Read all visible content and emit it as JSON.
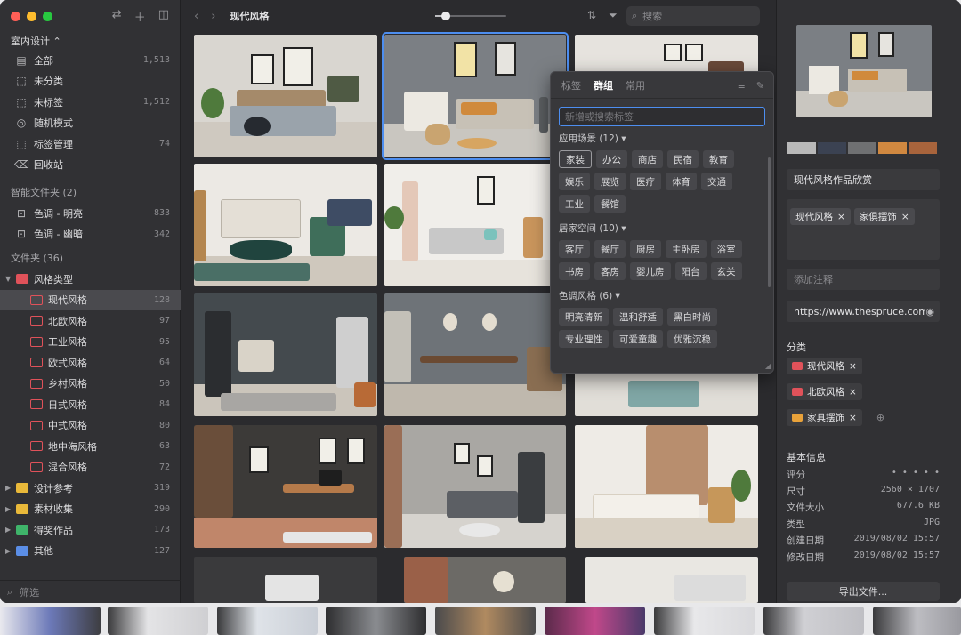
{
  "sidebar": {
    "library": "室内设计 ⌃",
    "items": [
      {
        "icon": "▤",
        "label": "全部",
        "count": "1,513"
      },
      {
        "icon": "⬚",
        "label": "未分类",
        "count": ""
      },
      {
        "icon": "⬚",
        "label": "未标签",
        "count": "1,512"
      },
      {
        "icon": "◎",
        "label": "随机模式",
        "count": ""
      },
      {
        "icon": "⬚",
        "label": "标签管理",
        "count": "74"
      },
      {
        "icon": "⌫",
        "label": "回收站",
        "count": ""
      }
    ],
    "smart_title": "智能文件夹 (2)",
    "smart": [
      {
        "label": "色调 - 明亮",
        "count": "833"
      },
      {
        "label": "色调 - 幽暗",
        "count": "342"
      }
    ],
    "folders_title": "文件夹 (36)",
    "style_root": {
      "label": "风格类型",
      "count": ""
    },
    "style_children": [
      {
        "label": "现代风格",
        "count": "128"
      },
      {
        "label": "北欧风格",
        "count": "97"
      },
      {
        "label": "工业风格",
        "count": "95"
      },
      {
        "label": "欧式风格",
        "count": "64"
      },
      {
        "label": "乡村风格",
        "count": "50"
      },
      {
        "label": "日式风格",
        "count": "84"
      },
      {
        "label": "中式风格",
        "count": "80"
      },
      {
        "label": "地中海风格",
        "count": "63"
      },
      {
        "label": "混合风格",
        "count": "72"
      }
    ],
    "others": [
      {
        "label": "设计参考",
        "count": "319",
        "color": "#e9b93a"
      },
      {
        "label": "素材收集",
        "count": "290",
        "color": "#e9b93a"
      },
      {
        "label": "得奖作品",
        "count": "173",
        "color": "#3fb46a"
      },
      {
        "label": "其他",
        "count": "127",
        "color": "#5b8ee6"
      }
    ],
    "filter_placeholder": "筛选"
  },
  "toolbar": {
    "title": "现代风格",
    "zoom": 0.15,
    "search_placeholder": "搜索"
  },
  "popover": {
    "tabs": [
      "标签",
      "群组",
      "常用"
    ],
    "active_tab": "群组",
    "input_placeholder": "新增或搜索标签",
    "groups": [
      {
        "title": "应用场景 (12) ▾",
        "tags": [
          "家装",
          "办公",
          "商店",
          "民宿",
          "教育",
          "娱乐",
          "展览",
          "医疗",
          "体育",
          "交通",
          "工业",
          "餐馆"
        ]
      },
      {
        "title": "居家空间 (10) ▾",
        "tags": [
          "客厅",
          "餐厅",
          "厨房",
          "主卧房",
          "浴室",
          "书房",
          "客房",
          "婴儿房",
          "阳台",
          "玄关"
        ]
      },
      {
        "title": "色调风格 (6) ▾",
        "tags": [
          "明亮清新",
          "温和舒适",
          "黑白时尚",
          "专业理性",
          "可爱童趣",
          "优雅沉稳"
        ]
      }
    ]
  },
  "inspector": {
    "palette": [
      "#b9b9b9",
      "#3b4252",
      "#6f7072",
      "#d08840",
      "#a8643c"
    ],
    "name": "现代风格作品欣赏",
    "tags": [
      "现代风格",
      "家俱摆饰"
    ],
    "note_placeholder": "添加注释",
    "url": "https://www.thespruce.com/",
    "category_label": "分类",
    "categories": [
      {
        "label": "现代风格",
        "color": "#e0525a"
      },
      {
        "label": "北欧风格",
        "color": "#e0525a"
      },
      {
        "label": "家具摆饰",
        "color": "#e9a23a"
      }
    ],
    "basic_label": "基本信息",
    "info": [
      {
        "k": "评分",
        "v": "• • • • •"
      },
      {
        "k": "尺寸",
        "v": "2560 × 1707"
      },
      {
        "k": "文件大小",
        "v": "677.6 KB"
      },
      {
        "k": "类型",
        "v": "JPG"
      },
      {
        "k": "创建日期",
        "v": "2019/08/02 15:57"
      },
      {
        "k": "修改日期",
        "v": "2019/08/02 15:57"
      }
    ],
    "export_label": "导出文件..."
  }
}
